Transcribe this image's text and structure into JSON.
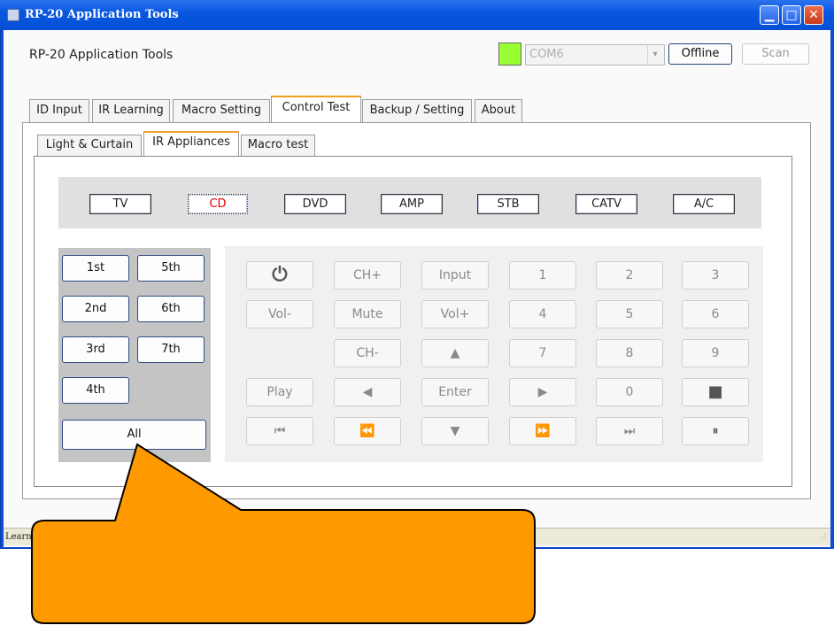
{
  "window": {
    "title": "RP-20 Application Tools",
    "minimize_glyph": "▁",
    "maximize_glyph": "□",
    "close_glyph": "✕"
  },
  "header": {
    "app_title": "RP-20 Application Tools",
    "status_color": "#99ff33",
    "com_port": "COM6",
    "combo_arrow": "▾",
    "offline_label": "Offline",
    "scan_label": "Scan"
  },
  "tabs": [
    "ID Input",
    "IR Learning",
    "Macro Setting",
    "Control Test",
    "Backup / Setting",
    "About"
  ],
  "active_tab": "Control Test",
  "subtabs": [
    "Light & Curtain",
    "IR Appliances",
    "Macro test"
  ],
  "active_subtab": "IR Appliances",
  "devices": [
    "TV",
    "CD",
    "DVD",
    "AMP",
    "STB",
    "CATV",
    "A/C"
  ],
  "selected_device": "CD",
  "zones": [
    "1st",
    "5th",
    "2nd",
    "6th",
    "3rd",
    "7th",
    "4th",
    "All"
  ],
  "keys": {
    "power": "⏻",
    "ch_up": "CH+",
    "input": "Input",
    "n1": "1",
    "n2": "2",
    "n3": "3",
    "vol_down": "Vol-",
    "mute": "Mute",
    "vol_up": "Vol+",
    "n4": "4",
    "n5": "5",
    "n6": "6",
    "ch_down": "CH-",
    "up": "▲",
    "n7": "7",
    "n8": "8",
    "n9": "9",
    "play": "Play",
    "left": "◀",
    "enter": "Enter",
    "right": "▶",
    "n0": "0",
    "stop": "■",
    "prev": "⏮",
    "rewind": "⏪",
    "down": "▼",
    "fast_forward": "⏩",
    "next": "⏭",
    "pause": "⏸"
  },
  "statusbar": {
    "text": "Learn"
  },
  "callout": {
    "fill": "#ff9900"
  },
  "accent": "#f0a020"
}
